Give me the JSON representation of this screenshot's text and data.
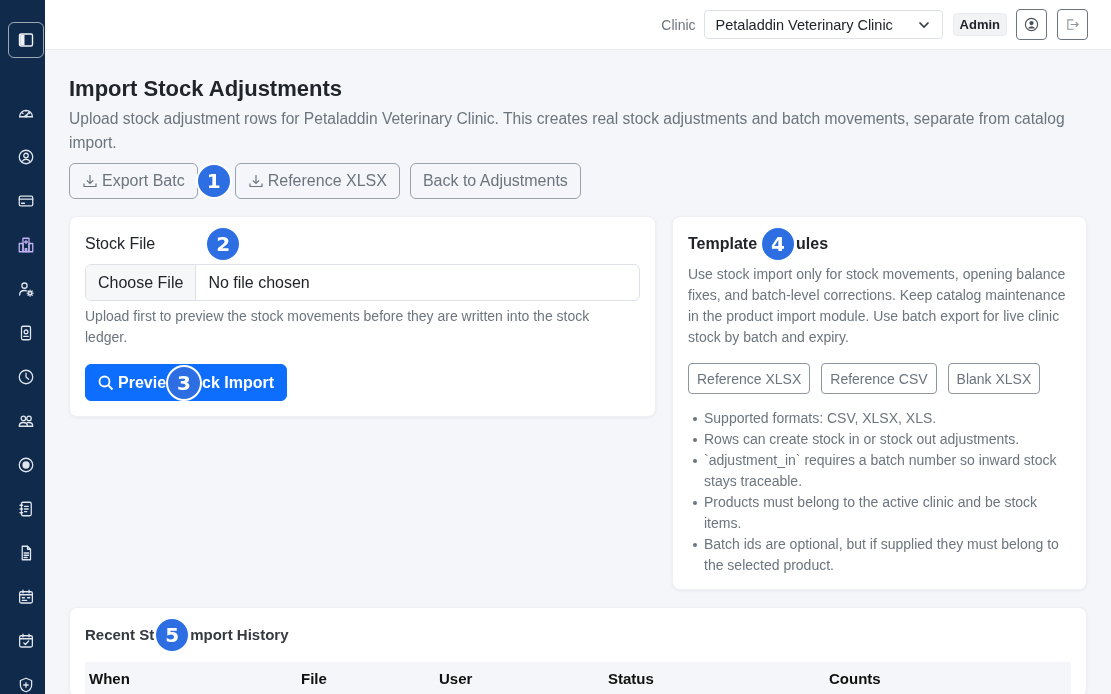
{
  "sidebar": {
    "items": [
      {
        "selected": false
      },
      {
        "selected": false
      },
      {
        "selected": false
      },
      {
        "selected": true
      },
      {
        "selected": false
      },
      {
        "selected": false
      },
      {
        "selected": false
      },
      {
        "selected": false
      },
      {
        "selected": false
      },
      {
        "selected": false
      },
      {
        "selected": false
      },
      {
        "selected": false
      },
      {
        "selected": false
      },
      {
        "selected": false
      }
    ]
  },
  "topbar": {
    "clinic_label": "Clinic",
    "clinic_select": {
      "value": "Petaladdin Veterinary Clinic"
    },
    "role": "Admin"
  },
  "page": {
    "title": "Import Stock Adjustments",
    "description": "Upload stock adjustment rows for Petaladdin Veterinary Clinic. This creates real stock adjustments and batch movements, separate from catalog import."
  },
  "actions": [
    {
      "label": "Export Batc",
      "kind": "download",
      "marker": "1"
    },
    {
      "label": "Reference XLSX",
      "kind": "download"
    },
    {
      "label": "Back to Adjustments",
      "kind": "plain"
    }
  ],
  "upload_card": {
    "label": "Stock File",
    "marker": "2",
    "file_input": {
      "button": "Choose File",
      "status": "No file chosen"
    },
    "help": "Upload first to preview the stock movements before they are written into the stock ledger.",
    "submit": {
      "label_parts": [
        "Previe",
        "ck Import"
      ],
      "marker": "3"
    }
  },
  "rules_card": {
    "title_parts": [
      "Template",
      "ules"
    ],
    "marker": "4",
    "description": "Use stock import only for stock movements, opening balance fixes, and batch-level corrections. Keep catalog maintenance in the product import module. Use batch export for live clinic stock by batch and expiry.",
    "templates": [
      "Reference XLSX",
      "Reference CSV",
      "Blank XLSX"
    ],
    "rules": [
      "Supported formats: CSV, XLSX, XLS.",
      "Rows can create stock in or stock out adjustments.",
      "`adjustment_in` requires a batch number so inward stock stays traceable.",
      "Products must belong to the active clinic and be stock items.",
      "Batch ids are optional, but if supplied they must belong to the selected product."
    ]
  },
  "history": {
    "title_parts": [
      "Recent St",
      "mport History"
    ],
    "marker": "5",
    "table": {
      "columns": [
        "When",
        "File",
        "User",
        "Status",
        "Counts"
      ]
    }
  }
}
